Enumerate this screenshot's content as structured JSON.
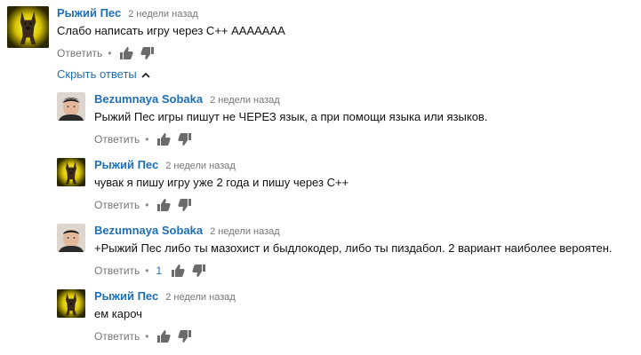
{
  "comments": [
    {
      "author": "Рыжий Пес",
      "time": "2 недели назад",
      "text": "Слабо написать игру через С++ ААААААА",
      "reply_label": "Ответить",
      "avatar": "fox-dog-avatar"
    }
  ],
  "hide_replies_label": "Скрыть ответы",
  "replies": [
    {
      "author": "Bezumnaya Sobaka",
      "time": "2 недели назад",
      "text": "Рыжий Пес игры пишут не ЧЕРЕЗ язык, а при помощи языка или языков.",
      "reply_label": "Ответить",
      "avatar": "man-portrait-avatar"
    },
    {
      "author": "Рыжий Пес",
      "time": "2 недели назад",
      "text": "чувак я пишу игру уже 2 года и пишу через С++",
      "reply_label": "Ответить",
      "avatar": "fox-dog-avatar"
    },
    {
      "author": "Bezumnaya Sobaka",
      "time": "2 недели назад",
      "text": "+Рыжий Пес либо ты мазохист и быдлокодер, либо ты пиздабол. 2 вариант наиболее вероятен.",
      "reply_label": "Ответить",
      "likes": "1",
      "avatar": "man-portrait-avatar"
    },
    {
      "author": "Рыжий Пес",
      "time": "2 недели назад",
      "text": "ем кароч",
      "reply_label": "Ответить",
      "avatar": "fox-dog-avatar"
    }
  ],
  "colors": {
    "link": "#1f6fb6",
    "muted": "#767676",
    "icon": "#6b6b6b"
  }
}
